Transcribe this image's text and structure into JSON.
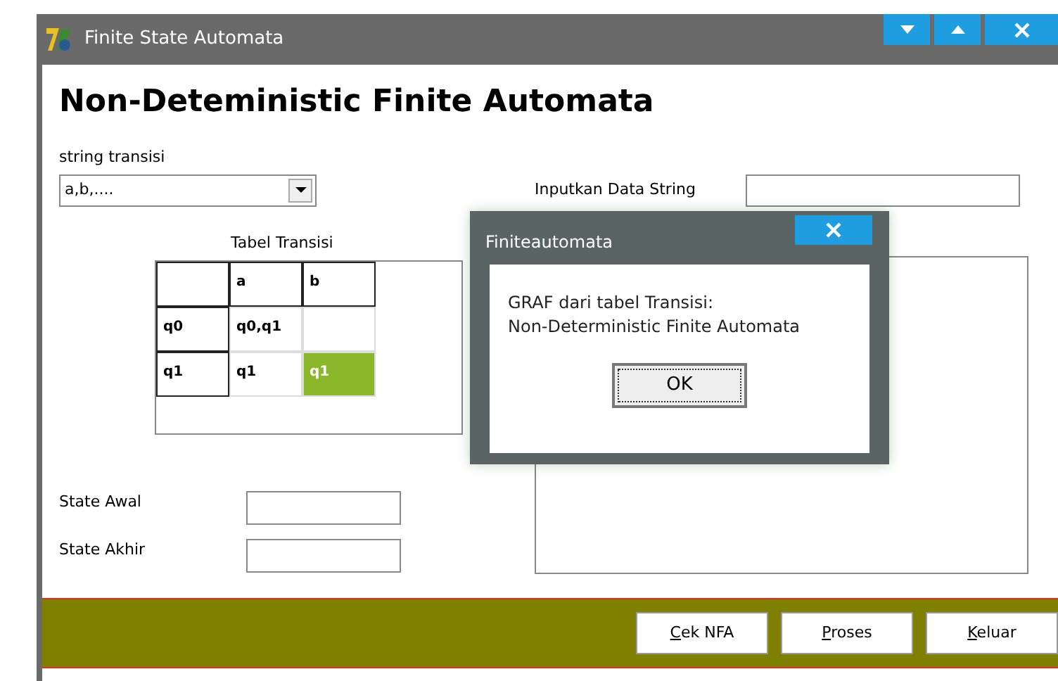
{
  "window": {
    "title": "Finite State Automata",
    "controls": [
      {
        "kind": "minimize"
      },
      {
        "kind": "maximize"
      },
      {
        "kind": "close"
      }
    ]
  },
  "heading": "Non-Deteministic Finite Automata",
  "string_transisi": {
    "label": "string transisi",
    "value": "a,b,...."
  },
  "table": {
    "title": "Tabel Transisi",
    "rows": [
      {
        "cells": [
          {
            "text": "",
            "header": true,
            "highlighted": false
          },
          {
            "text": "a",
            "header": true,
            "highlighted": false
          },
          {
            "text": "b",
            "header": true,
            "highlighted": false
          }
        ]
      },
      {
        "cells": [
          {
            "text": "q0",
            "header": true,
            "highlighted": false
          },
          {
            "text": "q0,q1",
            "header": false,
            "highlighted": false
          },
          {
            "text": "",
            "header": false,
            "highlighted": false
          }
        ]
      },
      {
        "cells": [
          {
            "text": "q1",
            "header": true,
            "highlighted": false
          },
          {
            "text": "q1",
            "header": false,
            "highlighted": false
          },
          {
            "text": "q1",
            "header": false,
            "highlighted": true
          }
        ]
      }
    ]
  },
  "state_awal": {
    "label": "State Awal"
  },
  "state_akhir": {
    "label": "State Akhir"
  },
  "input_string": {
    "label": "Inputkan Data String"
  },
  "buttons": [
    "Cek NFA",
    "Proses",
    "Keluar"
  ],
  "dialog": {
    "title": "Finiteautomata",
    "message": [
      "GRAF dari tabel Transisi:",
      "Non-Deterministic Finite Automata"
    ],
    "button": "OK"
  }
}
